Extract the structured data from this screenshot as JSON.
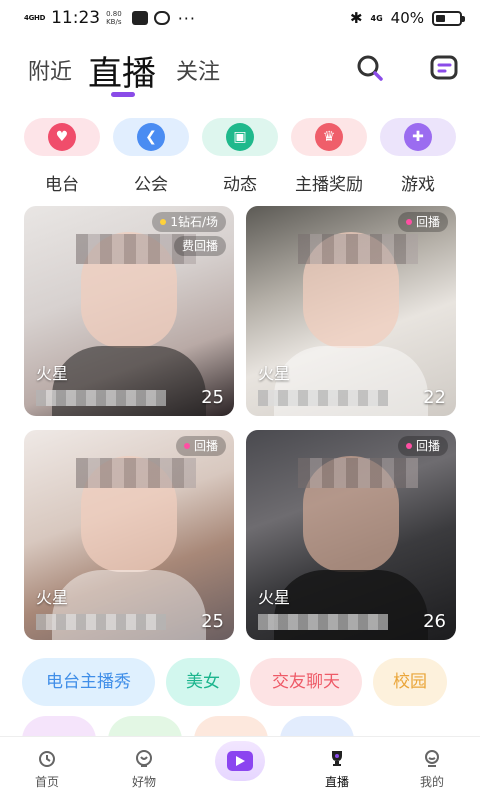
{
  "status_bar": {
    "network": "4GHD",
    "time": "11:23",
    "speed_value": "0.80",
    "speed_unit": "KB/s",
    "more": "···",
    "signal": "4G",
    "battery_text": "40%",
    "battery_level": 0.4
  },
  "top_tabs": {
    "nearby": "附近",
    "live": "直播",
    "follow": "关注",
    "accent_color": "#8a4be8"
  },
  "categories": [
    {
      "label": "电台",
      "icon": "radio-heart-icon",
      "color": "#f04d6b"
    },
    {
      "label": "公会",
      "icon": "wing-icon",
      "color": "#4a8cf2"
    },
    {
      "label": "动态",
      "icon": "feed-icon",
      "color": "#20b98c"
    },
    {
      "label": "主播奖励",
      "icon": "trophy-icon",
      "color": "#ef5e6a"
    },
    {
      "label": "游戏",
      "icon": "game-icon",
      "color": "#9b6cf0"
    }
  ],
  "streams": [
    {
      "badge": "1钻石/场",
      "badge2": "费回播",
      "location": "火星",
      "count": "25"
    },
    {
      "badge": "回播",
      "location": "火星",
      "count": "22"
    },
    {
      "badge": "回播",
      "location": "火星",
      "count": "25"
    },
    {
      "badge": "回播",
      "location": "火星",
      "count": "26"
    }
  ],
  "tags": [
    {
      "label": "电台主播秀"
    },
    {
      "label": "美女"
    },
    {
      "label": "交友聊天"
    },
    {
      "label": "校园"
    }
  ],
  "bottom_nav": {
    "home": "首页",
    "goods": "好物",
    "live": "直播",
    "me": "我的"
  }
}
